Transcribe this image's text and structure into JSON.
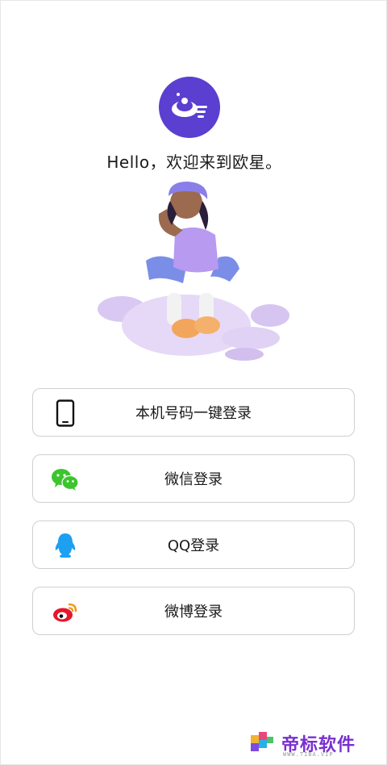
{
  "greeting": "Hello，欢迎来到欧星。",
  "login_options": {
    "phone": {
      "label": "本机号码一键登录",
      "icon": "phone-icon"
    },
    "wechat": {
      "label": "微信登录",
      "icon": "wechat-icon"
    },
    "qq": {
      "label": "QQ登录",
      "icon": "qq-penguin-icon"
    },
    "weibo": {
      "label": "微博登录",
      "icon": "weibo-icon"
    }
  },
  "watermark": {
    "brand": "帝标软件",
    "sub": "WWW.TIBA.VIP"
  },
  "colors": {
    "logo_bg": "#5a3fd0",
    "wechat_green": "#3cc52d",
    "qq_blue": "#1ea0f2",
    "weibo_red": "#e6162d",
    "border": "#cfcfcf"
  }
}
